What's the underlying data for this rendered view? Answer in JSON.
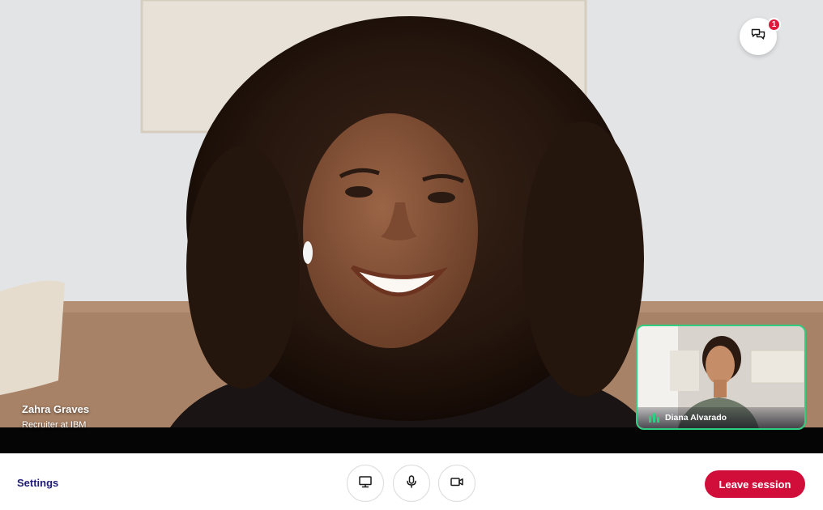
{
  "main_participant": {
    "name": "Zahra Graves",
    "role": "Recruiter at IBM"
  },
  "self_view": {
    "name": "Diana Alvarado",
    "speaking": true
  },
  "chat": {
    "icon": "chat-bubbles-icon",
    "unread_count": "1"
  },
  "controls": {
    "settings_label": "Settings",
    "screen_share_icon": "monitor-icon",
    "microphone_icon": "microphone-icon",
    "camera_icon": "video-camera-icon",
    "leave_label": "Leave session"
  },
  "colors": {
    "leave_button": "#d10d3a",
    "settings_text": "#1d1a78",
    "speaking_indicator": "#2fcf82",
    "badge": "#e0183c"
  }
}
